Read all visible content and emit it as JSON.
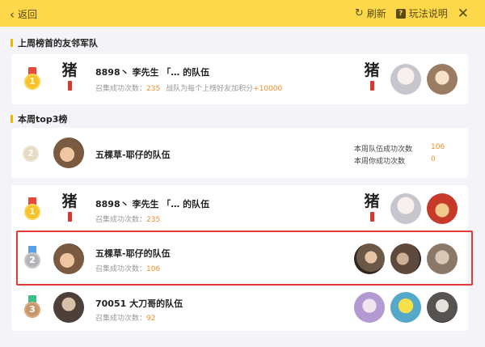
{
  "topbar": {
    "back_label": "返回",
    "refresh_label": "刷新",
    "help_label": "玩法说明",
    "help_icon_glyph": "?",
    "close_glyph": "✕"
  },
  "section_lastweek": {
    "title": "上周榜首的友邻军队",
    "team": {
      "rank": "1",
      "logo_char": "猪",
      "name": "8898丶 李先生 「… 的队伍",
      "stat_label": "召集成功次数：",
      "stat_value": "235",
      "bonus_text": "战队为每个上榜好友加积分",
      "bonus_value": "+10000"
    }
  },
  "section_top3": {
    "title": "本周top3榜",
    "my_team": {
      "rank": "2",
      "name": "五棵草-耶仔的队伍",
      "stat1_label": "本周队伍成功次数",
      "stat1_value": "106",
      "stat2_label": "本周你成功次数",
      "stat2_value": "0"
    },
    "rows": [
      {
        "rank": "1",
        "logo_char": "猪",
        "name": "8898丶 李先生 「… 的队伍",
        "stat_label": "召集成功次数：",
        "stat_value": "235"
      },
      {
        "rank": "2",
        "name": "五棵草-耶仔的队伍",
        "stat_label": "召集成功次数：",
        "stat_value": "106"
      },
      {
        "rank": "3",
        "name": "70051 大刀哥的队伍",
        "stat_label": "召集成功次数：",
        "stat_value": "92"
      }
    ]
  },
  "colors": {
    "topbar": "#fcd84a",
    "accent_orange": "#f08d2c",
    "highlight_red": "#e23a36",
    "page_bg": "#f4f3f8"
  }
}
